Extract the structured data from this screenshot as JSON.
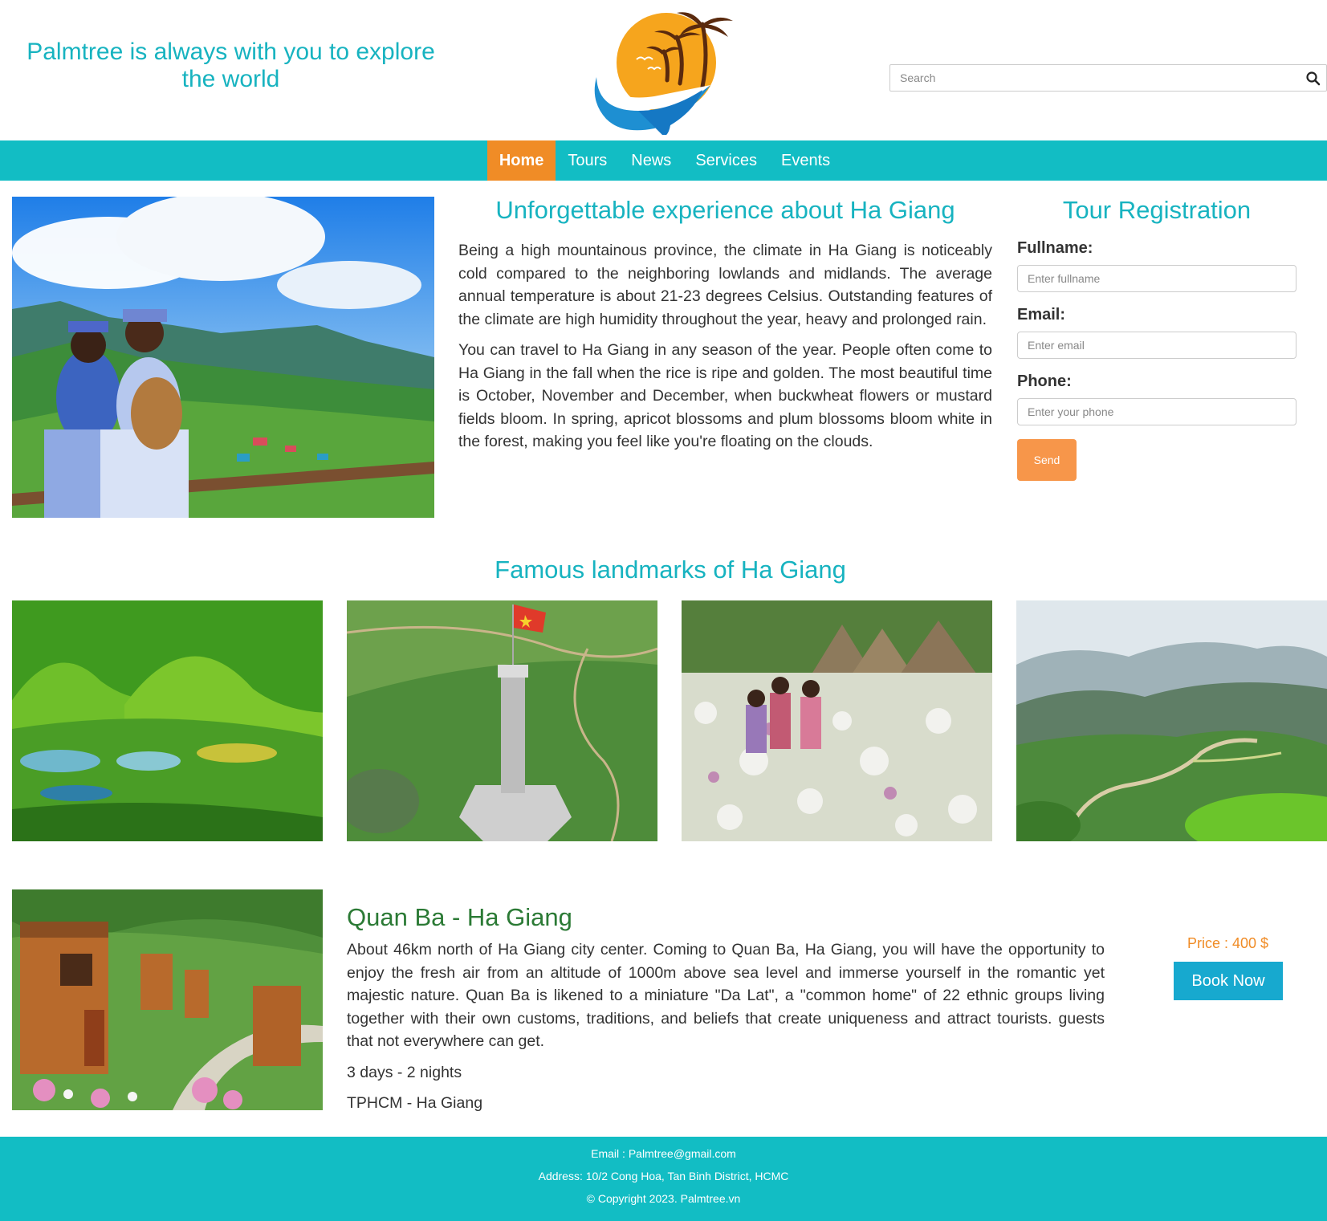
{
  "header": {
    "tagline": "Palmtree is always with you to explore the world",
    "search_placeholder": "Search",
    "logo_icon": "palmtree-logo-icon",
    "search_icon": "search-icon"
  },
  "nav": {
    "items": [
      "Home",
      "Tours",
      "News",
      "Services",
      "Events"
    ],
    "active": "Home"
  },
  "intro": {
    "title": "Unforgettable experience about Ha Giang",
    "paragraphs": [
      "Being a high mountainous province, the climate in Ha Giang is noticeably cold compared to the neighboring lowlands and midlands. The average annual temperature is about 21-23 degrees Celsius. Outstanding features of the climate are high humidity throughout the year, heavy and prolonged rain.",
      "You can travel to Ha Giang in any season of the year. People often come to Ha Giang in the fall when the rice is ripe and golden. The most beautiful time is October, November and December, when buckwheat flowers or mustard fields bloom. In spring, apricot blossoms and plum blossoms bloom white in the forest, making you feel like you're floating on the clouds."
    ]
  },
  "registration": {
    "title": "Tour Registration",
    "fullname_label": "Fullname:",
    "fullname_placeholder": "Enter fullname",
    "email_label": "Email:",
    "email_placeholder": "Enter email",
    "phone_label": "Phone:",
    "phone_placeholder": "Enter your phone",
    "send_label": "Send"
  },
  "landmarks": {
    "title": "Famous landmarks of Ha Giang"
  },
  "tour": {
    "title": "Quan Ba - Ha Giang",
    "description": "About 46km north of Ha Giang city center. Coming to Quan Ba, Ha Giang, you will have the opportunity to enjoy the fresh air from an altitude of 1000m above sea level and immerse yourself in the romantic yet majestic nature. Quan Ba is likened to a miniature \"Da Lat\", a \"common home\" of 22 ethnic groups living together with their own customs, traditions, and beliefs that create uniqueness and attract tourists. guests that not everywhere can get.",
    "duration": "3 days - 2 nights",
    "route": "TPHCM - Ha Giang",
    "price": "Price : 400 $",
    "book_label": "Book Now"
  },
  "footer": {
    "email": "Email : Palmtree@gmail.com",
    "address": "Address: 10/2 Cong Hoa, Tan Binh District, HCMC",
    "copyright": "© Copyright 2023. Palmtree.vn"
  },
  "colors": {
    "teal": "#12bdc4",
    "heading": "#17b3c0",
    "orange": "#f08c26",
    "send": "#f7964a",
    "book": "#17a9cf",
    "tour_title": "#2b7a35"
  }
}
